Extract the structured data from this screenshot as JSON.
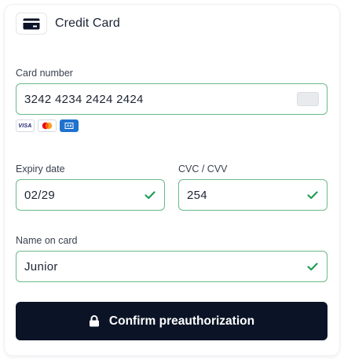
{
  "header": {
    "title": "Credit Card",
    "icon": "credit-card-icon"
  },
  "card_number": {
    "label": "Card number",
    "value": "3242 4234 2424 2424",
    "icon": "generic-card-icon"
  },
  "brands": [
    {
      "name": "visa-icon",
      "text": "VISA"
    },
    {
      "name": "mastercard-icon"
    },
    {
      "name": "amex-icon"
    }
  ],
  "expiry": {
    "label": "Expiry date",
    "value": "02/29",
    "valid": true
  },
  "cvc": {
    "label": "CVC / CVV",
    "value": "254",
    "valid": true
  },
  "name_on_card": {
    "label": "Name on card",
    "value": "Junior",
    "valid": true
  },
  "confirm_button": {
    "label": "Confirm preauthorization",
    "icon": "lock-icon"
  },
  "colors": {
    "primary_button": "#0b1426",
    "valid_border": "#6bb98a",
    "check": "#1f9d55"
  }
}
